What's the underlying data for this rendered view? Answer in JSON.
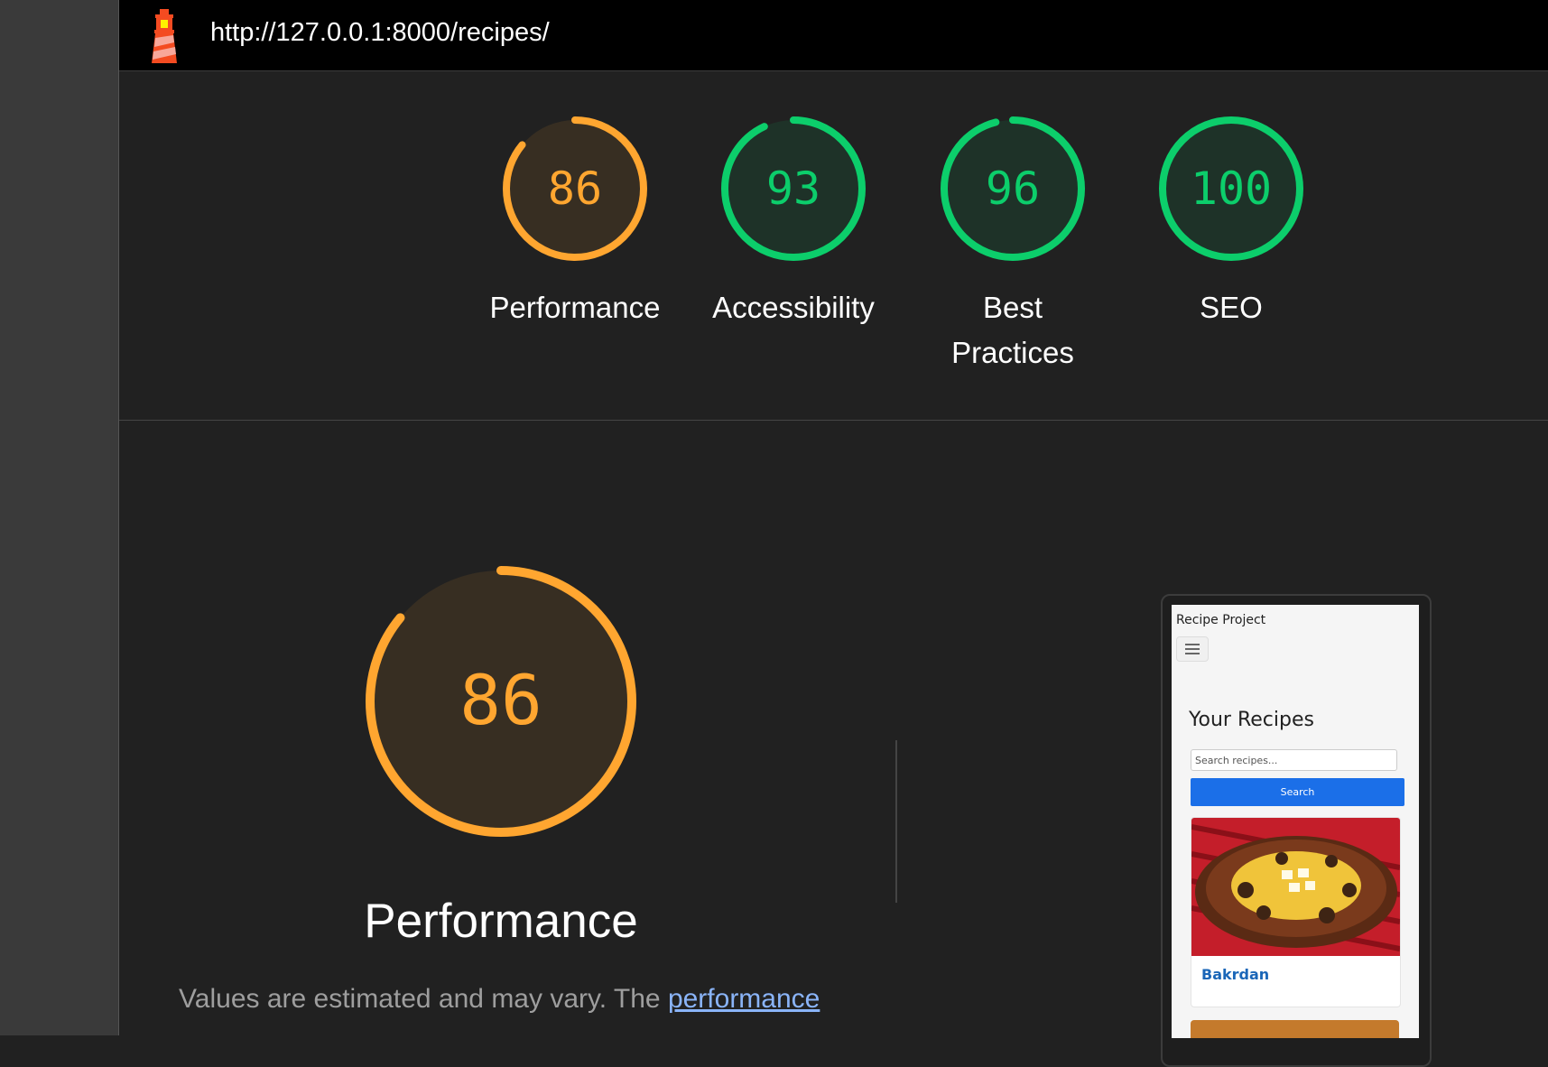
{
  "report": {
    "url": "http://127.0.0.1:8000/recipes/"
  },
  "colors": {
    "average": "#ffa630",
    "pass": "#0cce6b"
  },
  "categories": [
    {
      "label": "Performance",
      "score": 86,
      "status": "average"
    },
    {
      "label": "Accessibility",
      "score": 93,
      "status": "pass"
    },
    {
      "label": "Best Practices",
      "score": 96,
      "status": "pass"
    },
    {
      "label": "SEO",
      "score": 100,
      "status": "pass"
    }
  ],
  "detail": {
    "score": 86,
    "title": "Performance",
    "disclaimer_text": "Values are estimated and may vary. The ",
    "disclaimer_link": "performance"
  },
  "preview": {
    "brand": "Recipe Project",
    "heading": "Your Recipes",
    "search_placeholder": "Search recipes...",
    "search_button": "Search",
    "recipe_title": "Bakrdan"
  }
}
